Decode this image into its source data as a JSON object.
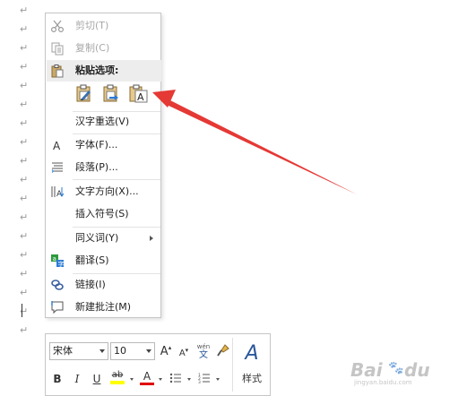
{
  "context_menu": {
    "items": {
      "cut": {
        "label": "剪切(T)",
        "icon": "scissors-icon"
      },
      "copy": {
        "label": "复制(C)",
        "icon": "copy-icon"
      },
      "paste_options": {
        "label": "粘贴选项:",
        "icon": "clipboard-icon"
      },
      "reconvert": {
        "label": "汉字重选(V)"
      },
      "font": {
        "label": "字体(F)...",
        "icon": "font-icon"
      },
      "paragraph": {
        "label": "段落(P)...",
        "icon": "paragraph-icon"
      },
      "text_direction": {
        "label": "文字方向(X)...",
        "icon": "text-direction-icon"
      },
      "insert_symbol": {
        "label": "插入符号(S)"
      },
      "synonyms": {
        "label": "同义词(Y)"
      },
      "translate": {
        "label": "翻译(S)",
        "icon": "translate-icon"
      },
      "link": {
        "label": "链接(I)",
        "icon": "link-icon"
      },
      "new_comment": {
        "label": "新建批注(M)",
        "icon": "comment-icon"
      }
    },
    "paste_buttons": [
      {
        "name": "keep-source-formatting",
        "icon": "paste-keep-format-icon"
      },
      {
        "name": "merge-formatting",
        "icon": "paste-merge-format-icon"
      },
      {
        "name": "keep-text-only",
        "icon": "paste-text-only-icon"
      }
    ]
  },
  "mini_toolbar": {
    "font_name": "宋体",
    "font_size": "10",
    "grow_font": "A",
    "shrink_font": "A",
    "phonetic_guide": "wén",
    "phonetic_char": "文",
    "bold": "B",
    "italic": "I",
    "underline": "U",
    "highlight": "ab",
    "font_color": "A",
    "styles_label": "样式",
    "styles_glyph": "A"
  },
  "colors": {
    "arrow": "#e53935",
    "highlight": "#ffff00",
    "font_color": "#e00000",
    "styles_accent": "#2b579a"
  },
  "watermark": {
    "text": "Bai",
    "paw": "du",
    "sub": "jingyan.baidu.com"
  },
  "paragraph_marks": [
    "↵",
    "↵",
    "↵",
    "↵",
    "↵",
    "↵",
    "↵",
    "↵",
    "↵",
    "↵",
    "↵",
    "↵",
    "↵",
    "↵",
    "↵",
    "↵",
    "↵",
    "↵",
    "↵",
    "↵",
    "↵",
    "↵",
    "↵",
    "↵",
    "↵",
    "↵",
    "↵",
    "↵",
    "↵"
  ]
}
